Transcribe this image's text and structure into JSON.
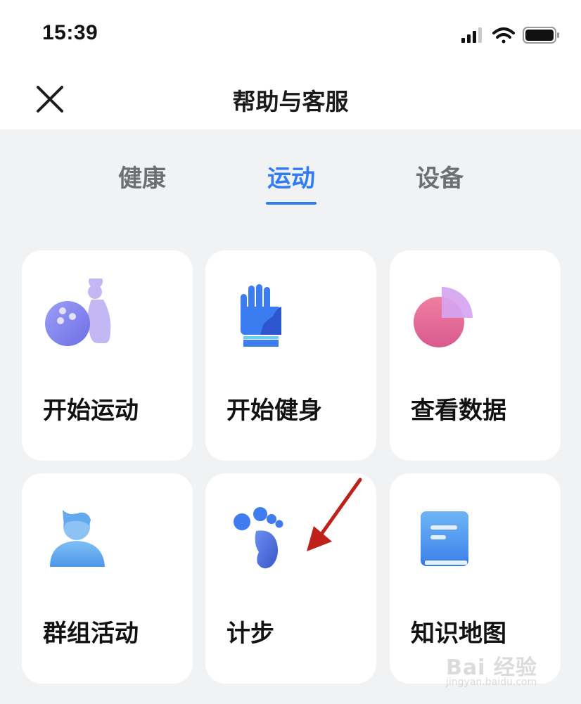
{
  "status_bar": {
    "time": "15:39"
  },
  "header": {
    "title": "帮助与客服"
  },
  "tabs": [
    {
      "label": "健康",
      "active": false
    },
    {
      "label": "运动",
      "active": true
    },
    {
      "label": "设备",
      "active": false
    }
  ],
  "cards": [
    {
      "label": "开始运动",
      "icon": "bowling-icon"
    },
    {
      "label": "开始健身",
      "icon": "glove-icon"
    },
    {
      "label": "查看数据",
      "icon": "pie-chart-icon"
    },
    {
      "label": "群组活动",
      "icon": "person-icon"
    },
    {
      "label": "计步",
      "icon": "footprint-icon"
    },
    {
      "label": "知识地图",
      "icon": "book-icon"
    }
  ],
  "watermark": {
    "main": "Bai  经验",
    "sub": "jingyan.baidu.com"
  },
  "colors": {
    "accent": "#2f7cf5",
    "annotation_arrow": "#c0201a",
    "background": "#f1f2f4"
  }
}
